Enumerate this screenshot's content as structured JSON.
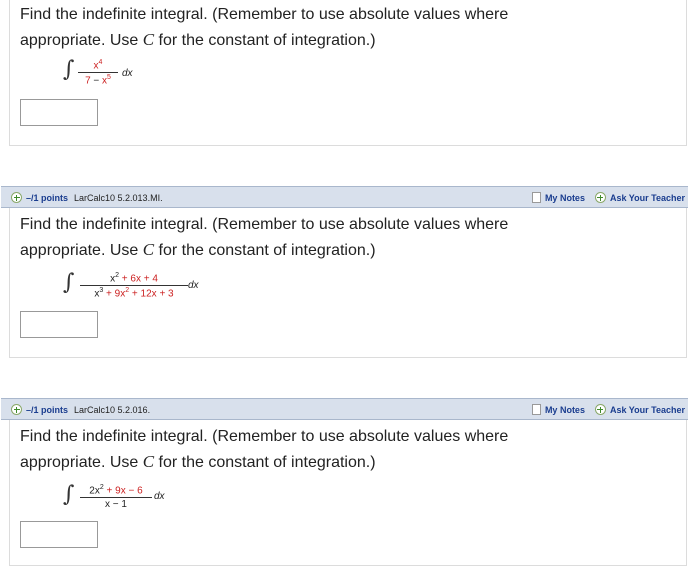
{
  "instructions": {
    "line1": "Find the indefinite integral. (Remember to use absolute values where",
    "line2_pre": "appropriate. Use ",
    "line2_c": "C",
    "line2_post": " for the constant of integration.)"
  },
  "questions": [
    {
      "numerator": "x",
      "numerator_exp": "4",
      "denominator_a": "7",
      "denominator_op": " − ",
      "denominator_b": "x",
      "denominator_exp": "5",
      "dx": "dx",
      "answer": ""
    },
    {
      "points": "–/1 points",
      "source": "LarCalc10 5.2.013.MI.",
      "my_notes": "My Notes",
      "ask_teacher": "Ask Your Teacher",
      "num_a": "x",
      "num_a_exp": "2",
      "num_b": " + 6x + 4",
      "den_a": "x",
      "den_a_exp": "3",
      "den_b": " + 9x",
      "den_b_exp": "2",
      "den_c": " + 12x + 3",
      "dx": "dx",
      "answer": ""
    },
    {
      "points": "–/1 points",
      "source": "LarCalc10 5.2.016.",
      "my_notes": "My Notes",
      "ask_teacher": "Ask Your Teacher",
      "num_a": "2x",
      "num_a_exp": "2",
      "num_b": " + 9x − 6",
      "den": "x − 1",
      "dx": "dx",
      "answer": ""
    }
  ],
  "colors": {
    "header_bg": "#d8e0ec",
    "link": "#1a3d8f",
    "math_red": "#cc2222"
  }
}
